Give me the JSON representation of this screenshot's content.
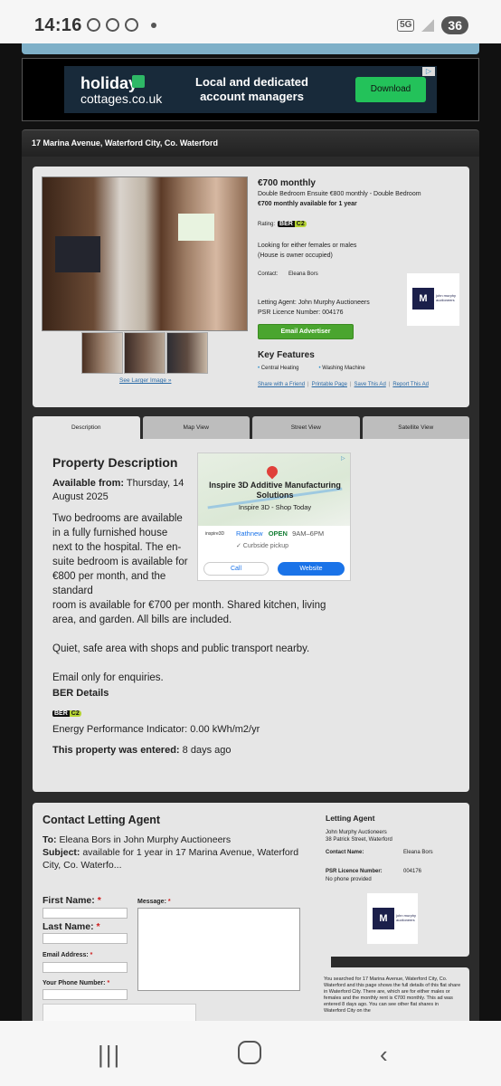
{
  "status_bar": {
    "time": "14:16",
    "network": "5G",
    "battery": "36"
  },
  "ad": {
    "logo_line1": "holiday",
    "logo_line2": "cottages.co.uk",
    "message": "Local and dedicated account managers",
    "button": "Download"
  },
  "address_bar": "17 Marina Avenue, Waterford City, Co. Waterford",
  "listing": {
    "price": "€700 monthly",
    "desc_line1": "Double Bedroom Ensuite €800 monthly - Double Bedroom",
    "desc_line2": "€700 monthly available for 1 year",
    "rating_label": "Rating:",
    "ber_label": "BER",
    "ber_value": "C2",
    "looking": "Looking for either females or males",
    "occupied": "(House is owner occupied)",
    "contact_label": "Contact:",
    "contact_name": "Eleana Bors",
    "agent_line": "Letting Agent: John Murphy Auctioneers",
    "psr_line": "PSR Licence Number: 004176",
    "email_button": "Email Advertiser",
    "see_larger": "See Larger Image »",
    "key_features_title": "Key Features",
    "features": [
      "Central Heating",
      "Washing Machine"
    ],
    "links": [
      "Share with a Friend",
      "Printable Page",
      "Save This Ad",
      "Report This Ad"
    ],
    "link_sep": "|"
  },
  "tabs": [
    "Description",
    "Map View",
    "Street View",
    "Satellite View"
  ],
  "description": {
    "title": "Property Description",
    "available_label": "Available from:",
    "available_value": "Thursday, 14 August 2025",
    "para1": "Two bedrooms are available in a fully furnished house next to the hospital. The en-suite bedroom is available for €800 per month, and the standard room is available for €700 per month. Shared kitchen, living area, and garden. All bills are included.",
    "para2": "Quiet, safe area with shops and public transport nearby.",
    "para3": "Email only for enquiries.",
    "ber_details_title": "BER Details",
    "energy": "Energy Performance Indicator: 0.00 kWh/m2/yr",
    "entered_label": "This property was entered:",
    "entered_value": "8 days ago"
  },
  "map_ad": {
    "title": "Inspire 3D Additive Manufacturing Solutions",
    "subtitle": "Inspire 3D - Shop Today",
    "place": "Rathnew",
    "open": "OPEN",
    "hours": "9AM–6PM",
    "curbside": "✓ Curbside pickup",
    "call": "Call",
    "website": "Website",
    "logo_text": "inspire3D"
  },
  "contact_form": {
    "title": "Contact Letting Agent",
    "to_label": "To:",
    "to_value": "Eleana Bors in John Murphy Auctioneers",
    "subject_label": "Subject:",
    "subject_value": "available for 1 year in 17 Marina Avenue, Waterford City, Co. Waterfo...",
    "first_name": "First Name:",
    "last_name": "Last Name:",
    "email": "Email Address:",
    "phone": "Your Phone Number:",
    "message": "Message:",
    "required": "*"
  },
  "agent_box": {
    "title": "Letting Agent",
    "name": "John Murphy Auctioneers",
    "address": "38 Patrick Street, Waterford",
    "contact_label": "Contact Name:",
    "contact_value": "Eleana Bors",
    "psr_label": "PSR Licence Number:",
    "psr_value": "004176",
    "no_phone": "No phone provided",
    "logo_letter": "M",
    "logo_text": "john murphy auctioneers"
  },
  "search_box": "You searched for 17 Marina Avenue, Waterford City, Co. Waterford and this page shows the full details of this flat share in Waterford City. There are, which are for either males or females and the monthly rent is €700 monthly. This ad was entered 8 days ago. You can see other flat shares in Waterford City on the"
}
